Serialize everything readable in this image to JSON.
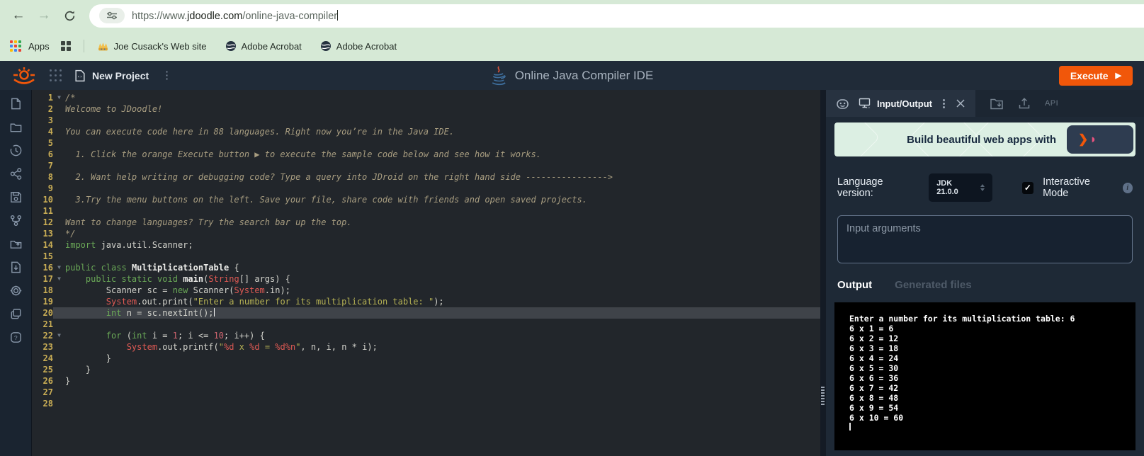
{
  "colors": {
    "accent_orange": "#f1570a",
    "chrome_green": "#d6e9d6",
    "header_bg": "#202b38",
    "editor_bg": "#22262b",
    "console_bg": "#000000",
    "keyword_green": "#6aa857",
    "type_red": "#e05a54",
    "string_olive": "#b6b254",
    "comment_tan": "#a89d80",
    "ad_mint": "#dcefe3"
  },
  "browser": {
    "url_scheme": "https://www.",
    "url_domain": "jdoodle.com",
    "url_path": "/online-java-compiler",
    "apps_label": "Apps",
    "bookmarks": [
      {
        "label": "Joe Cusack's Web site",
        "icon": "mascot"
      },
      {
        "label": "Adobe Acrobat",
        "icon": "globe"
      },
      {
        "label": "Adobe Acrobat",
        "icon": "globe"
      }
    ]
  },
  "header": {
    "project_name": "New Project",
    "title": "Online Java Compiler IDE",
    "execute_label": "Execute",
    "execute_play": "▶"
  },
  "sidebar": {
    "icons": [
      "new-file",
      "open-folder",
      "history",
      "share",
      "save",
      "fork",
      "open-project",
      "download",
      "settings",
      "duplicate",
      "help"
    ]
  },
  "editor": {
    "active_line": 20,
    "lines": [
      {
        "n": 1,
        "fold": true,
        "segs": [
          [
            "/*",
            "c"
          ]
        ]
      },
      {
        "n": 2,
        "segs": [
          [
            "Welcome to JDoodle!",
            "c"
          ]
        ]
      },
      {
        "n": 3,
        "segs": []
      },
      {
        "n": 4,
        "segs": [
          [
            "You can execute code here in 88 languages. Right now you’re in the Java IDE.",
            "c"
          ]
        ]
      },
      {
        "n": 5,
        "segs": []
      },
      {
        "n": 6,
        "segs": [
          [
            "  1. Click the orange Execute button ▶ to execute the sample code below and see how it works.",
            "c"
          ]
        ]
      },
      {
        "n": 7,
        "segs": []
      },
      {
        "n": 8,
        "segs": [
          [
            "  2. Want help writing or debugging code? Type a query into JDroid on the right hand side ---------------->",
            "c"
          ]
        ]
      },
      {
        "n": 9,
        "segs": []
      },
      {
        "n": 10,
        "segs": [
          [
            "  3.Try the menu buttons on the left. Save your file, share code with friends and open saved projects.",
            "c"
          ]
        ]
      },
      {
        "n": 11,
        "segs": []
      },
      {
        "n": 12,
        "segs": [
          [
            "Want to change languages? Try the search bar up the top.",
            "c"
          ]
        ]
      },
      {
        "n": 13,
        "segs": [
          [
            "*/",
            "c"
          ]
        ]
      },
      {
        "n": 14,
        "segs": [
          [
            "import",
            "k"
          ],
          [
            " java.util.Scanner;",
            "p"
          ]
        ]
      },
      {
        "n": 15,
        "segs": []
      },
      {
        "n": 16,
        "fold": true,
        "segs": [
          [
            "public class",
            "k"
          ],
          [
            " ",
            "p"
          ],
          [
            "MultiplicationTable",
            "b"
          ],
          [
            " {",
            "p"
          ]
        ]
      },
      {
        "n": 17,
        "fold": true,
        "segs": [
          [
            "    ",
            "p"
          ],
          [
            "public static void",
            "k"
          ],
          [
            " ",
            "p"
          ],
          [
            "main",
            "b"
          ],
          [
            "(",
            "p"
          ],
          [
            "String",
            "r"
          ],
          [
            "[] args) {",
            "p"
          ]
        ]
      },
      {
        "n": 18,
        "segs": [
          [
            "        Scanner sc = ",
            "p"
          ],
          [
            "new",
            "k"
          ],
          [
            " Scanner(",
            "p"
          ],
          [
            "System",
            "r"
          ],
          [
            ".in);",
            "p"
          ]
        ]
      },
      {
        "n": 19,
        "segs": [
          [
            "        ",
            "p"
          ],
          [
            "System",
            "r"
          ],
          [
            ".out.print(",
            "p"
          ],
          [
            "\"Enter a number for its multiplication table: \"",
            "s"
          ],
          [
            ");",
            "p"
          ]
        ]
      },
      {
        "n": 20,
        "segs": [
          [
            "        ",
            "p"
          ],
          [
            "int",
            "k"
          ],
          [
            " n = sc.nextInt();",
            "p"
          ]
        ]
      },
      {
        "n": 21,
        "segs": []
      },
      {
        "n": 22,
        "fold": true,
        "segs": [
          [
            "        ",
            "p"
          ],
          [
            "for",
            "k"
          ],
          [
            " (",
            "p"
          ],
          [
            "int",
            "k"
          ],
          [
            " i = ",
            "p"
          ],
          [
            "1",
            "n"
          ],
          [
            "; i <= ",
            "p"
          ],
          [
            "10",
            "n"
          ],
          [
            "; i++) {",
            "p"
          ]
        ]
      },
      {
        "n": 23,
        "segs": [
          [
            "            ",
            "p"
          ],
          [
            "System",
            "r"
          ],
          [
            ".out.printf(",
            "p"
          ],
          [
            "\"",
            "s"
          ],
          [
            "%d",
            "r"
          ],
          [
            " x ",
            "s"
          ],
          [
            "%d",
            "r"
          ],
          [
            " = ",
            "s"
          ],
          [
            "%d",
            "r"
          ],
          [
            "%n",
            "r"
          ],
          [
            "\"",
            "s"
          ],
          [
            ", n, i, n * i);",
            "p"
          ]
        ]
      },
      {
        "n": 24,
        "segs": [
          [
            "        }",
            "p"
          ]
        ]
      },
      {
        "n": 25,
        "segs": [
          [
            "    }",
            "p"
          ]
        ]
      },
      {
        "n": 26,
        "segs": [
          [
            "}",
            "p"
          ]
        ]
      },
      {
        "n": 27,
        "segs": []
      },
      {
        "n": 28,
        "segs": []
      }
    ]
  },
  "panel": {
    "tab_label": "Input/Output",
    "api_label": "API",
    "ad_text": "Build beautiful web apps with",
    "language_version_label": "Language version:",
    "language_version_value": "JDK 21.0.0",
    "interactive_checkmark": "✓",
    "interactive_mode_label": "Interactive Mode",
    "info_glyph": "i",
    "input_args_placeholder": "Input arguments",
    "output_tab": "Output",
    "generated_tab": "Generated files",
    "console_lines": [
      "Enter a number for its multiplication table: 6",
      "6 x 1 = 6",
      "6 x 2 = 12",
      "6 x 3 = 18",
      "6 x 4 = 24",
      "6 x 5 = 30",
      "6 x 6 = 36",
      "6 x 7 = 42",
      "6 x 8 = 48",
      "6 x 9 = 54",
      "6 x 10 = 60"
    ]
  }
}
